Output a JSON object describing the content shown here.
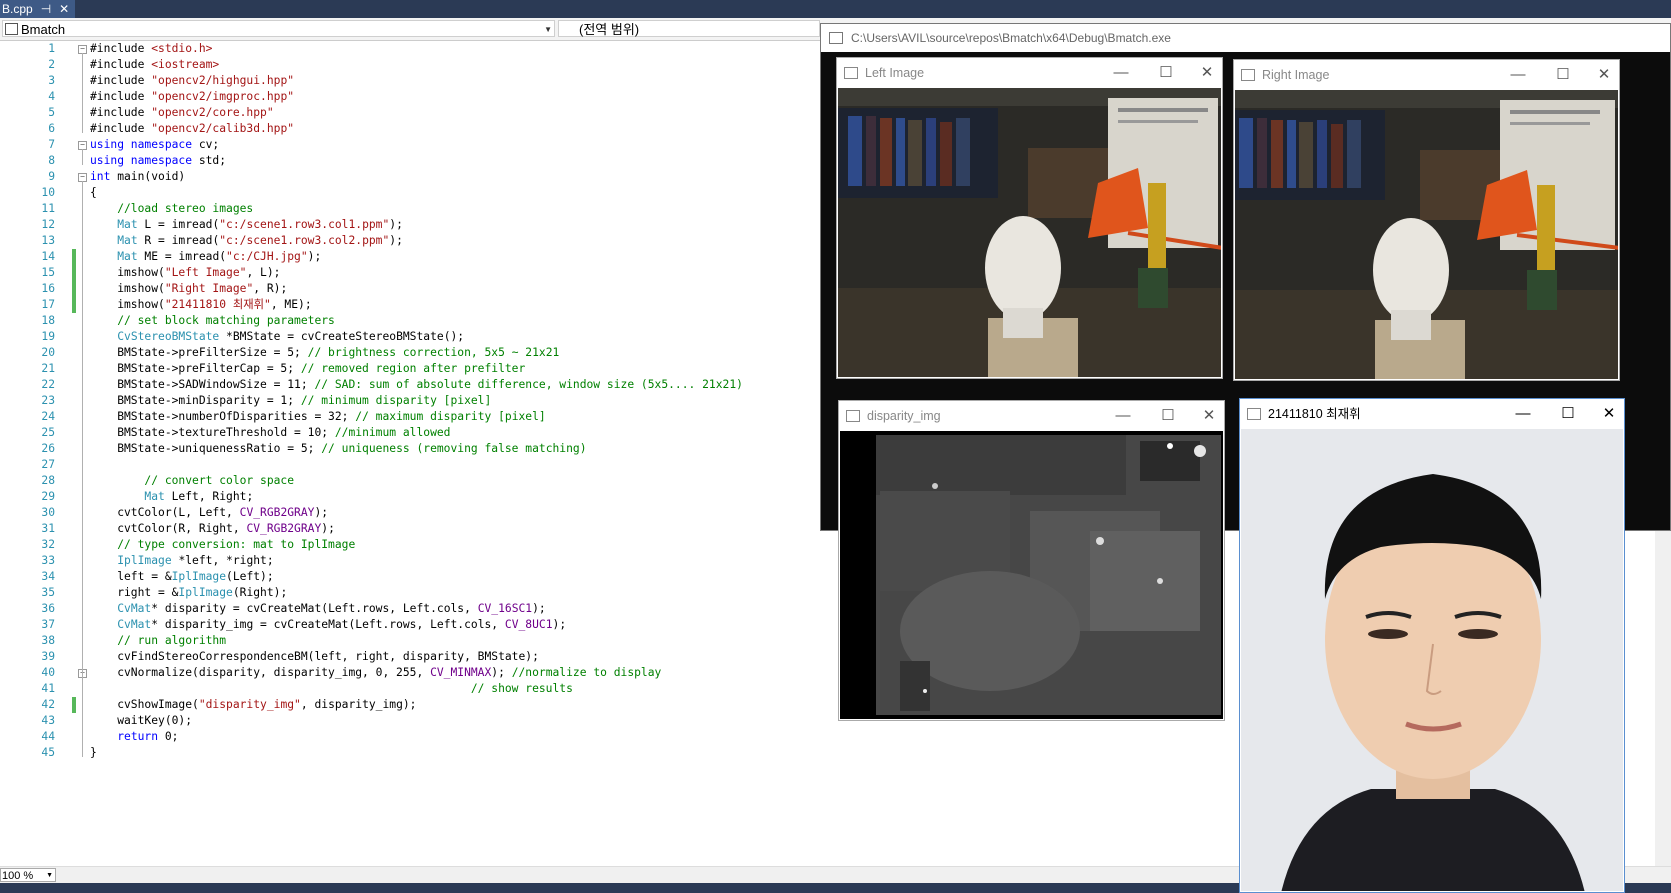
{
  "tab": {
    "title": "B.cpp",
    "pin": "⊣",
    "close": "✕"
  },
  "nav": {
    "project": "Bmatch",
    "scope": "(전역 범위)"
  },
  "code_lines": [
    {
      "n": "1",
      "f": "-",
      "g": false,
      "t": [
        [
          "#include ",
          ""
        ],
        [
          "<stdio.h>",
          "st"
        ]
      ]
    },
    {
      "n": "2",
      "f": "",
      "g": false,
      "t": [
        [
          "#include ",
          ""
        ],
        [
          "<iostream>",
          "st"
        ]
      ]
    },
    {
      "n": "3",
      "f": "",
      "g": false,
      "t": [
        [
          "#include ",
          ""
        ],
        [
          "\"opencv2/highgui.hpp\"",
          "st"
        ]
      ]
    },
    {
      "n": "4",
      "f": "",
      "g": false,
      "t": [
        [
          "#include ",
          ""
        ],
        [
          "\"opencv2/imgproc.hpp\"",
          "st"
        ]
      ]
    },
    {
      "n": "5",
      "f": "",
      "g": false,
      "t": [
        [
          "#include ",
          ""
        ],
        [
          "\"opencv2/core.hpp\"",
          "st"
        ]
      ]
    },
    {
      "n": "6",
      "f": "",
      "g": false,
      "t": [
        [
          "#include ",
          ""
        ],
        [
          "\"opencv2/calib3d.hpp\"",
          "st"
        ]
      ]
    },
    {
      "n": "7",
      "f": "-",
      "g": false,
      "t": [
        [
          "using namespace",
          "kw"
        ],
        [
          " cv;",
          ""
        ]
      ]
    },
    {
      "n": "8",
      "f": "",
      "g": false,
      "t": [
        [
          "using namespace",
          "kw"
        ],
        [
          " std;",
          ""
        ]
      ]
    },
    {
      "n": "9",
      "f": "-",
      "g": false,
      "t": [
        [
          "int",
          "kw"
        ],
        [
          " main(void)",
          ""
        ]
      ]
    },
    {
      "n": "10",
      "f": "",
      "g": false,
      "t": [
        [
          "{",
          ""
        ]
      ]
    },
    {
      "n": "11",
      "f": "",
      "g": false,
      "t": [
        [
          "    //load stereo images",
          "cm"
        ]
      ]
    },
    {
      "n": "12",
      "f": "",
      "g": false,
      "t": [
        [
          "    ",
          ""
        ],
        [
          "Mat",
          "ty"
        ],
        [
          " L = imread(",
          ""
        ],
        [
          "\"c:/scene1.row3.col1.ppm\"",
          "st"
        ],
        [
          ");",
          ""
        ]
      ]
    },
    {
      "n": "13",
      "f": "",
      "g": false,
      "t": [
        [
          "    ",
          ""
        ],
        [
          "Mat",
          "ty"
        ],
        [
          " R = imread(",
          ""
        ],
        [
          "\"c:/scene1.row3.col2.ppm\"",
          "st"
        ],
        [
          ");",
          ""
        ]
      ]
    },
    {
      "n": "14",
      "f": "",
      "g": true,
      "t": [
        [
          "    ",
          ""
        ],
        [
          "Mat",
          "ty"
        ],
        [
          " ME = imread(",
          ""
        ],
        [
          "\"c:/CJH.jpg\"",
          "st"
        ],
        [
          ");",
          ""
        ]
      ]
    },
    {
      "n": "15",
      "f": "",
      "g": true,
      "t": [
        [
          "    imshow(",
          ""
        ],
        [
          "\"Left Image\"",
          "st"
        ],
        [
          ", L);",
          ""
        ]
      ]
    },
    {
      "n": "16",
      "f": "",
      "g": true,
      "t": [
        [
          "    imshow(",
          ""
        ],
        [
          "\"Right Image\"",
          "st"
        ],
        [
          ", R);",
          ""
        ]
      ]
    },
    {
      "n": "17",
      "f": "",
      "g": true,
      "t": [
        [
          "    imshow(",
          ""
        ],
        [
          "\"21411810 최재휘\"",
          "st"
        ],
        [
          ", ME);",
          ""
        ]
      ]
    },
    {
      "n": "18",
      "f": "",
      "g": false,
      "t": [
        [
          "    // set block matching parameters",
          "cm"
        ]
      ]
    },
    {
      "n": "19",
      "f": "",
      "g": false,
      "t": [
        [
          "    ",
          ""
        ],
        [
          "CvStereoBMState",
          "ty"
        ],
        [
          " *BMState = cvCreateStereoBMState();",
          ""
        ]
      ]
    },
    {
      "n": "20",
      "f": "",
      "g": false,
      "t": [
        [
          "    BMState->preFilterSize = 5; ",
          ""
        ],
        [
          "// brightness correction, 5x5 ~ 21x21",
          "cm"
        ]
      ]
    },
    {
      "n": "21",
      "f": "",
      "g": false,
      "t": [
        [
          "    BMState->preFilterCap = 5; ",
          ""
        ],
        [
          "// removed region after prefilter",
          "cm"
        ]
      ]
    },
    {
      "n": "22",
      "f": "",
      "g": false,
      "t": [
        [
          "    BMState->SADWindowSize = 11; ",
          ""
        ],
        [
          "// SAD: sum of absolute difference, window size (5x5.... 21x21)",
          "cm"
        ]
      ]
    },
    {
      "n": "23",
      "f": "",
      "g": false,
      "t": [
        [
          "    BMState->minDisparity = 1; ",
          ""
        ],
        [
          "// minimum disparity [pixel]",
          "cm"
        ]
      ]
    },
    {
      "n": "24",
      "f": "",
      "g": false,
      "t": [
        [
          "    BMState->numberOfDisparities = 32; ",
          ""
        ],
        [
          "// maximum disparity [pixel]",
          "cm"
        ]
      ]
    },
    {
      "n": "25",
      "f": "",
      "g": false,
      "t": [
        [
          "    BMState->textureThreshold = 10; ",
          ""
        ],
        [
          "//minimum allowed",
          "cm"
        ]
      ]
    },
    {
      "n": "26",
      "f": "",
      "g": false,
      "t": [
        [
          "    BMState->uniquenessRatio = 5; ",
          ""
        ],
        [
          "// uniqueness (removing false matching)",
          "cm"
        ]
      ]
    },
    {
      "n": "27",
      "f": "",
      "g": false,
      "t": [
        [
          "",
          ""
        ]
      ]
    },
    {
      "n": "28",
      "f": "",
      "g": false,
      "t": [
        [
          "        // convert color space",
          "cm"
        ]
      ]
    },
    {
      "n": "29",
      "f": "",
      "g": false,
      "t": [
        [
          "        ",
          ""
        ],
        [
          "Mat",
          "ty"
        ],
        [
          " Left, Right;",
          ""
        ]
      ]
    },
    {
      "n": "30",
      "f": "",
      "g": false,
      "t": [
        [
          "    cvtColor(L, Left, ",
          ""
        ],
        [
          "CV_RGB2GRAY",
          "mc"
        ],
        [
          ");",
          ""
        ]
      ]
    },
    {
      "n": "31",
      "f": "",
      "g": false,
      "t": [
        [
          "    cvtColor(R, Right, ",
          ""
        ],
        [
          "CV_RGB2GRAY",
          "mc"
        ],
        [
          ");",
          ""
        ]
      ]
    },
    {
      "n": "32",
      "f": "",
      "g": false,
      "t": [
        [
          "    // type conversion: mat to IplImage",
          "cm"
        ]
      ]
    },
    {
      "n": "33",
      "f": "",
      "g": false,
      "t": [
        [
          "    ",
          ""
        ],
        [
          "IplImage",
          "ty"
        ],
        [
          " *left, *right;",
          ""
        ]
      ]
    },
    {
      "n": "34",
      "f": "",
      "g": false,
      "t": [
        [
          "    left = &",
          ""
        ],
        [
          "IplImage",
          "ty"
        ],
        [
          "(Left);",
          ""
        ]
      ]
    },
    {
      "n": "35",
      "f": "",
      "g": false,
      "t": [
        [
          "    right = &",
          ""
        ],
        [
          "IplImage",
          "ty"
        ],
        [
          "(Right);",
          ""
        ]
      ]
    },
    {
      "n": "36",
      "f": "",
      "g": false,
      "t": [
        [
          "    ",
          ""
        ],
        [
          "CvMat",
          "ty"
        ],
        [
          "* disparity = cvCreateMat(Left.rows, Left.cols, ",
          ""
        ],
        [
          "CV_16SC1",
          "mc"
        ],
        [
          ");",
          ""
        ]
      ]
    },
    {
      "n": "37",
      "f": "",
      "g": false,
      "t": [
        [
          "    ",
          ""
        ],
        [
          "CvMat",
          "ty"
        ],
        [
          "* disparity_img = cvCreateMat(Left.rows, Left.cols, ",
          ""
        ],
        [
          "CV_8UC1",
          "mc"
        ],
        [
          ");",
          ""
        ]
      ]
    },
    {
      "n": "38",
      "f": "",
      "g": false,
      "t": [
        [
          "    // run algorithm",
          "cm"
        ]
      ]
    },
    {
      "n": "39",
      "f": "",
      "g": false,
      "t": [
        [
          "    cvFindStereoCorrespondenceBM(left, right, disparity, BMState);",
          ""
        ]
      ]
    },
    {
      "n": "40",
      "f": "-",
      "g": false,
      "t": [
        [
          "    cvNormalize(disparity, disparity_img, 0, 255, ",
          ""
        ],
        [
          "CV_MINMAX",
          "mc"
        ],
        [
          "); ",
          ""
        ],
        [
          "//normalize to display",
          "cm"
        ]
      ]
    },
    {
      "n": "41",
      "f": "",
      "g": false,
      "t": [
        [
          "                                                        // show results",
          "cm"
        ]
      ]
    },
    {
      "n": "42",
      "f": "",
      "g": true,
      "t": [
        [
          "    cvShowImage(",
          ""
        ],
        [
          "\"disparity_img\"",
          "st"
        ],
        [
          ", disparity_img);",
          ""
        ]
      ]
    },
    {
      "n": "43",
      "f": "",
      "g": false,
      "t": [
        [
          "    waitKey(0);",
          ""
        ]
      ]
    },
    {
      "n": "44",
      "f": "",
      "g": false,
      "t": [
        [
          "    ",
          ""
        ],
        [
          "return",
          "kw"
        ],
        [
          " 0;",
          ""
        ]
      ]
    },
    {
      "n": "45",
      "f": "",
      "g": false,
      "t": [
        [
          "}",
          ""
        ]
      ]
    }
  ],
  "zoom": "100 %",
  "console": {
    "title": "C:\\Users\\AVIL\\source\\repos\\Bmatch\\x64\\Debug\\Bmatch.exe"
  },
  "windows": {
    "left": {
      "title": "Left Image"
    },
    "right": {
      "title": "Right Image"
    },
    "disparity": {
      "title": "disparity_img"
    },
    "portrait": {
      "title": "21411810 최재휘"
    }
  },
  "controls": {
    "min": "—",
    "max": "☐",
    "close": "✕"
  },
  "colors": {
    "keyword": "#0000ff",
    "string": "#a31515",
    "comment": "#008000",
    "type": "#2b91af",
    "macro": "#6f008a",
    "line_number": "#2b91af",
    "change_bar": "#57b85a"
  }
}
